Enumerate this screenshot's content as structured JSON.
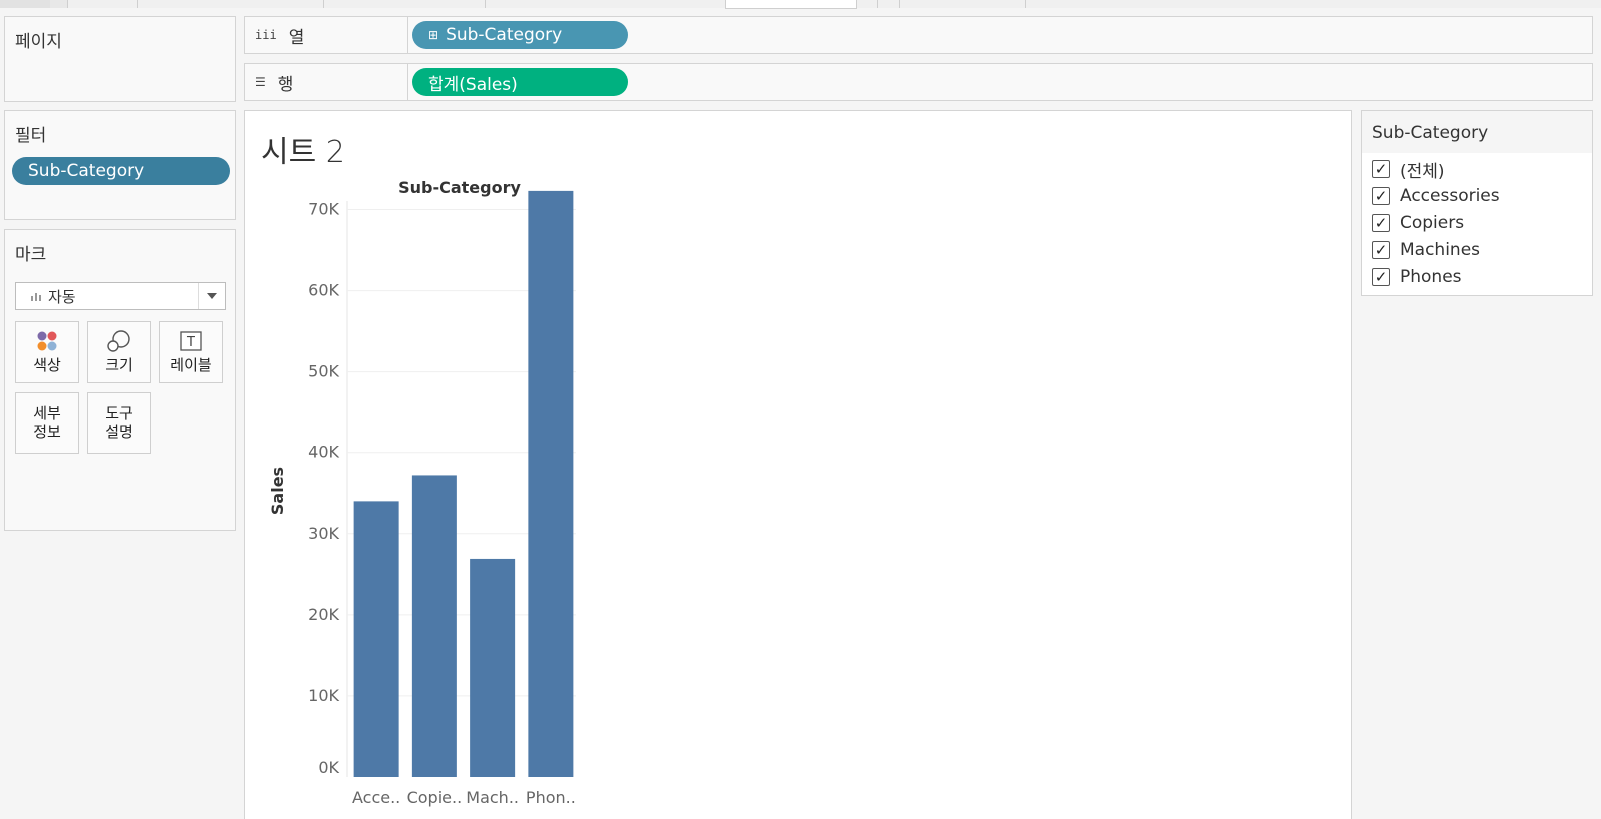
{
  "panels": {
    "pages_title": "페이지",
    "filters_title": "필터",
    "marks_title": "마크"
  },
  "shelves": {
    "columns_label": "열",
    "columns_pill": "Sub-Category",
    "rows_label": "행",
    "rows_pill": "합계(Sales)"
  },
  "filters": {
    "pill": "Sub-Category"
  },
  "marks": {
    "type_value": "자동",
    "buttons": {
      "color": "색상",
      "size": "크기",
      "label": "레이블",
      "detail_line1": "세부",
      "detail_line2": "정보",
      "tooltip_line1": "도구",
      "tooltip_line2": "설명"
    }
  },
  "sheet": {
    "title": "시트 2"
  },
  "legend": {
    "title": "Sub-Category",
    "items": [
      "(전체)",
      "Accessories",
      "Copiers",
      "Machines",
      "Phones"
    ]
  },
  "colors": {
    "bar": "#4e79a7",
    "columns_pill": "#4996b2",
    "rows_pill": "#00b180",
    "filter_pill": "#3a7f9e"
  },
  "chart_data": {
    "type": "bar",
    "title": "Sub-Category",
    "ylabel": "Sales",
    "categories": [
      "Acce..",
      "Copie..",
      "Mach..",
      "Phon.."
    ],
    "full_categories": [
      "Accessories",
      "Copiers",
      "Machines",
      "Phones"
    ],
    "values": [
      34000,
      37200,
      26900,
      72300
    ],
    "ylim": [
      0,
      75000
    ],
    "yticks": [
      0,
      10000,
      20000,
      30000,
      40000,
      50000,
      60000,
      70000
    ],
    "ytick_labels": [
      "0K",
      "10K",
      "20K",
      "30K",
      "40K",
      "50K",
      "60K",
      "70K"
    ],
    "grid": true
  }
}
